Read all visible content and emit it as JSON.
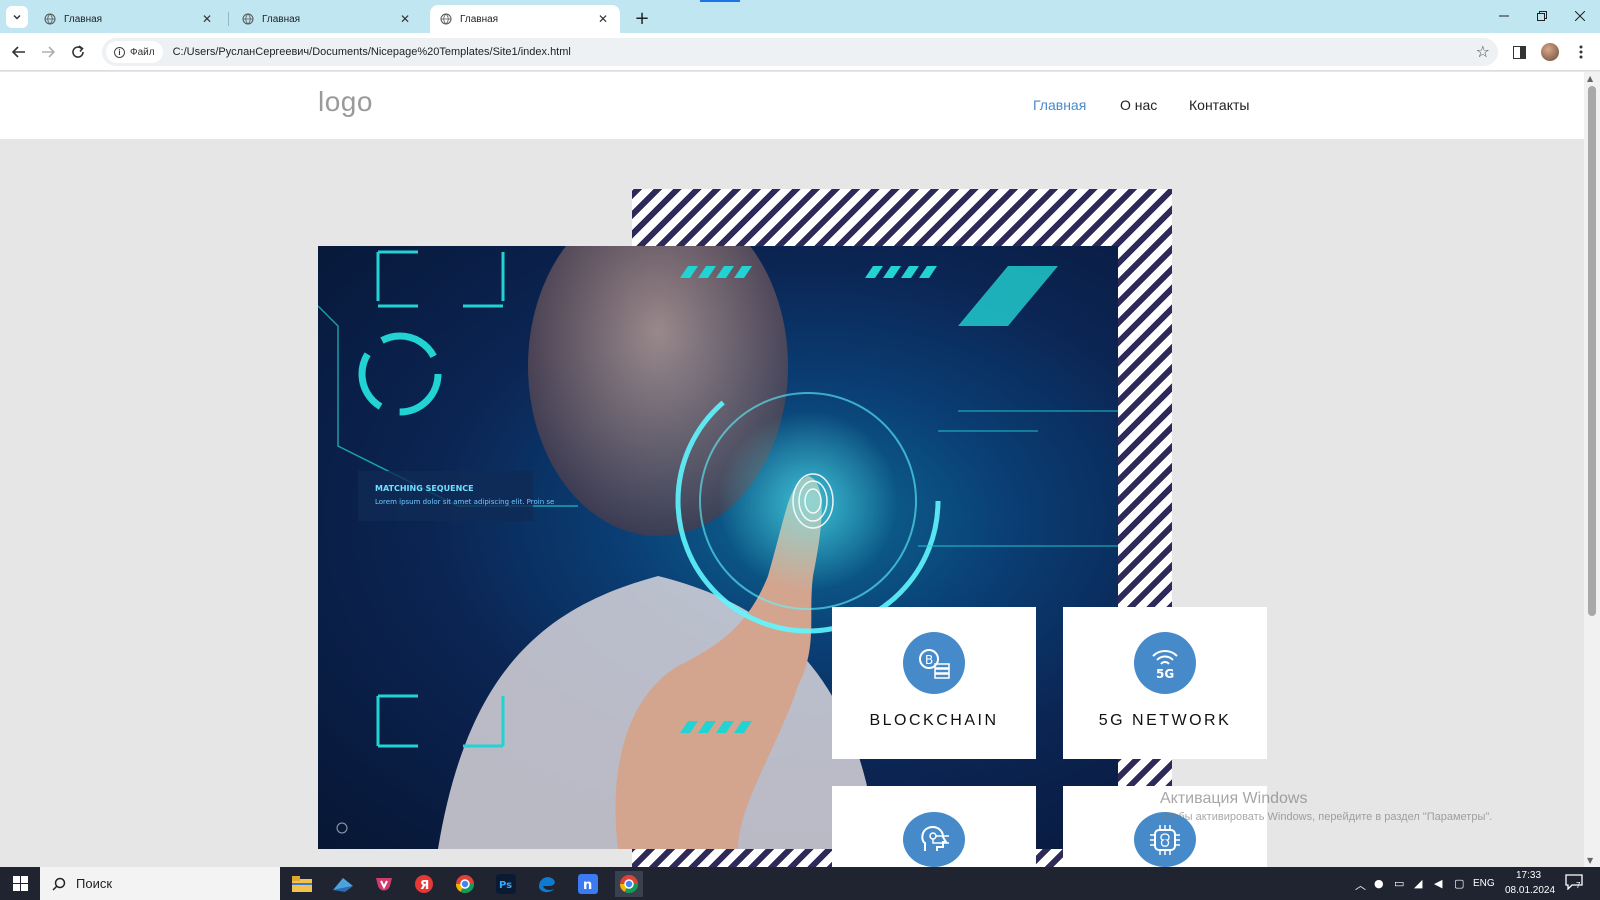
{
  "browser": {
    "tabs": [
      {
        "title": "Главная",
        "active": false
      },
      {
        "title": "Главная",
        "active": false
      },
      {
        "title": "Главная",
        "active": true
      }
    ],
    "new_tab_glyph": "+",
    "site_chip_label": "Файл",
    "url": "C:/Users/РусланСергеевич/Documents/Nicepage%20Templates/Site1/index.html"
  },
  "site": {
    "logo": "logo",
    "nav": [
      "Главная",
      "О нас",
      "Контакты"
    ],
    "accent_color": "#478ac9",
    "cards": [
      {
        "title": "BLOCKCHAIN",
        "icon": "blockchain-icon"
      },
      {
        "title": "5G NETWORK",
        "icon": "5g-network-icon"
      },
      {
        "title": "",
        "icon": "ai-head-icon"
      },
      {
        "title": "",
        "icon": "ai-chip-brain-icon"
      }
    ],
    "hero_overlay": {
      "label": "MATCHING SEQUENCE",
      "lorem": "Lorem ipsum dolor sit amet adipiscing elit. Proin se"
    }
  },
  "watermark": {
    "title": "Активация Windows",
    "text": "Чтобы активировать Windows, перейдите в раздел \"Параметры\"."
  },
  "taskbar": {
    "search_placeholder": "Поиск",
    "apps": [
      "file-explorer",
      "email",
      "vivaldi",
      "yandex",
      "chrome",
      "photoshop",
      "edge",
      "nicepage",
      "chrome-active"
    ],
    "ps_label": "Ps",
    "ya_label": "Я",
    "np_label": "n",
    "lang": "ENG",
    "time": "17:33",
    "date": "08.01.2024",
    "notifications": "7"
  }
}
